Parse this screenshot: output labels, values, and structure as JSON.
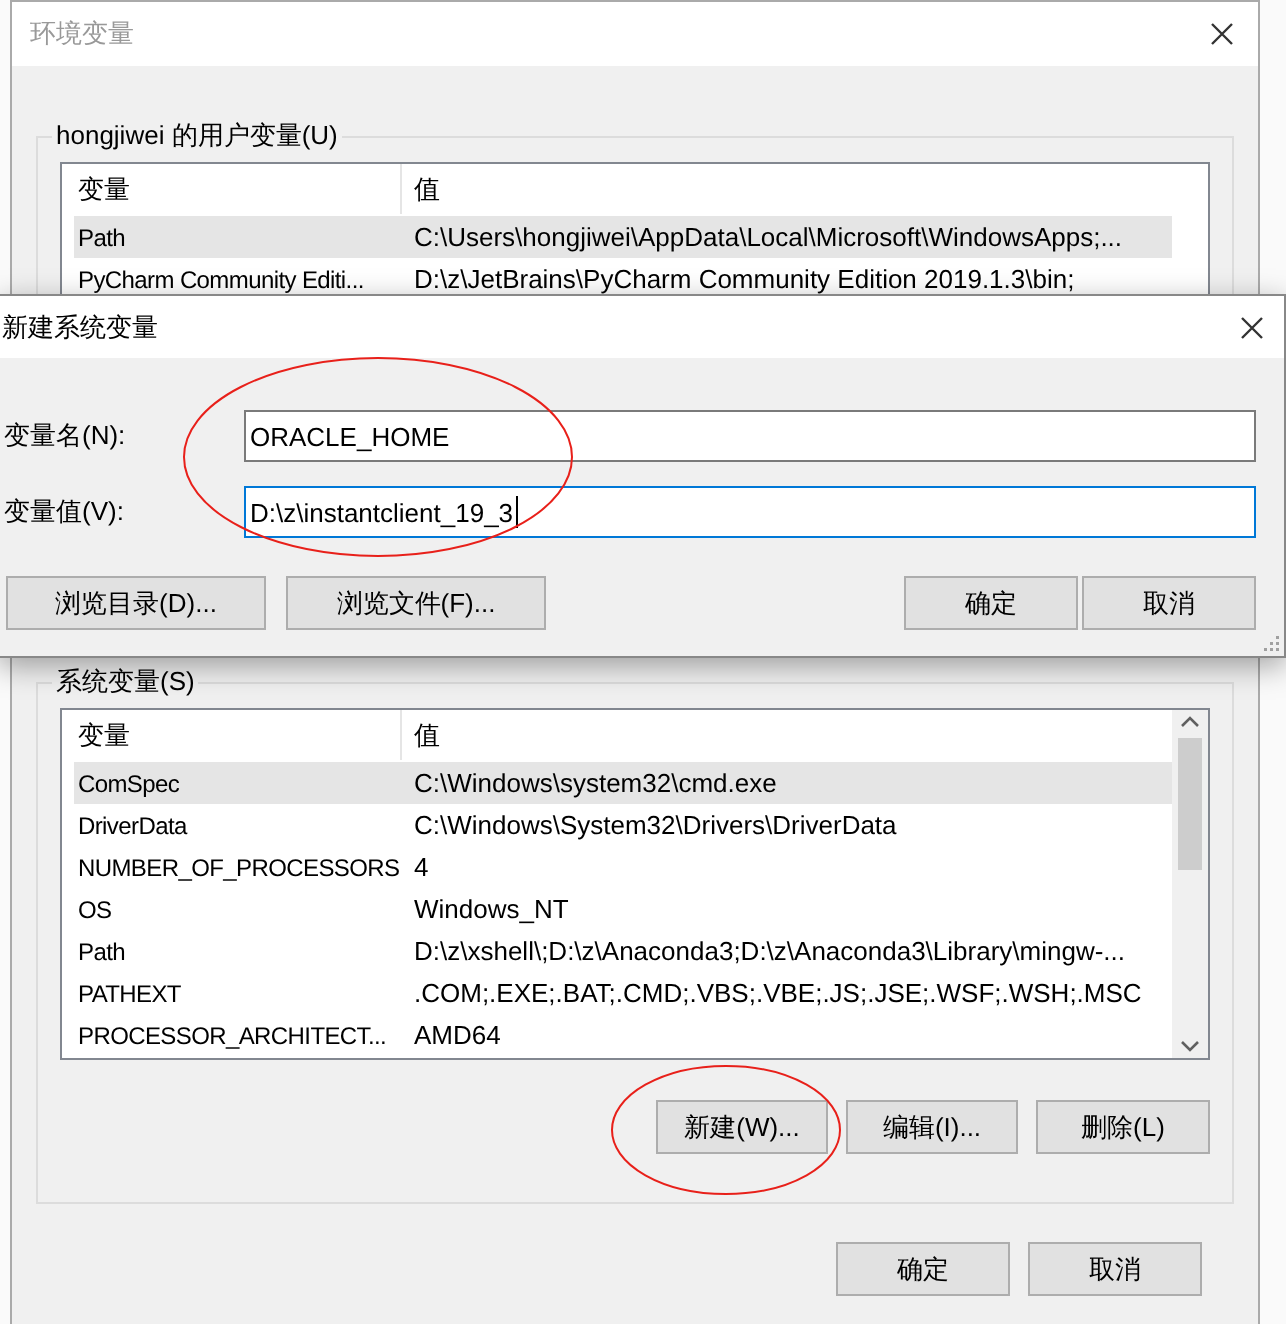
{
  "main_window": {
    "title": "环境变量",
    "user_variables": {
      "label": "hongjiwei 的用户变量(U)",
      "columns": [
        "变量",
        "值"
      ],
      "rows": [
        {
          "name": "Path",
          "value": "C:\\Users\\hongjiwei\\AppData\\Local\\Microsoft\\WindowsApps;...",
          "selected": true
        },
        {
          "name": "PyCharm Community Editi...",
          "value": "D:\\z\\JetBrains\\PyCharm Community Edition 2019.1.3\\bin;",
          "selected": false
        }
      ]
    },
    "system_variables": {
      "label": "系统变量(S)",
      "columns": [
        "变量",
        "值"
      ],
      "rows": [
        {
          "name": "ComSpec",
          "value": "C:\\Windows\\system32\\cmd.exe",
          "selected": true
        },
        {
          "name": "DriverData",
          "value": "C:\\Windows\\System32\\Drivers\\DriverData",
          "selected": false
        },
        {
          "name": "NUMBER_OF_PROCESSORS",
          "value": "4",
          "selected": false
        },
        {
          "name": "OS",
          "value": "Windows_NT",
          "selected": false
        },
        {
          "name": "Path",
          "value": "D:\\z\\xshell\\;D:\\z\\Anaconda3;D:\\z\\Anaconda3\\Library\\mingw-...",
          "selected": false
        },
        {
          "name": "PATHEXT",
          "value": ".COM;.EXE;.BAT;.CMD;.VBS;.VBE;.JS;.JSE;.WSF;.WSH;.MSC",
          "selected": false
        },
        {
          "name": "PROCESSOR_ARCHITECT...",
          "value": "AMD64",
          "selected": false
        }
      ],
      "buttons": [
        {
          "label": "新建(W)...",
          "circled": true
        },
        {
          "label": "编辑(I)...",
          "circled": false
        },
        {
          "label": "删除(L)",
          "circled": false
        }
      ]
    },
    "buttons": [
      "确定",
      "取消"
    ]
  },
  "dialog": {
    "title": "新建系统变量",
    "fields_circled": true,
    "fields": [
      {
        "label": "变量名(N):",
        "value": "ORACLE_HOME",
        "focused": false
      },
      {
        "label": "变量值(V):",
        "value": "D:\\z\\instantclient_19_3",
        "focused": true
      }
    ],
    "buttons": [
      {
        "label": "浏览目录(D)...",
        "kind": "browse"
      },
      {
        "label": "浏览文件(F)...",
        "kind": "browse"
      },
      {
        "label": "确定",
        "kind": "action"
      },
      {
        "label": "取消",
        "kind": "action"
      }
    ]
  }
}
